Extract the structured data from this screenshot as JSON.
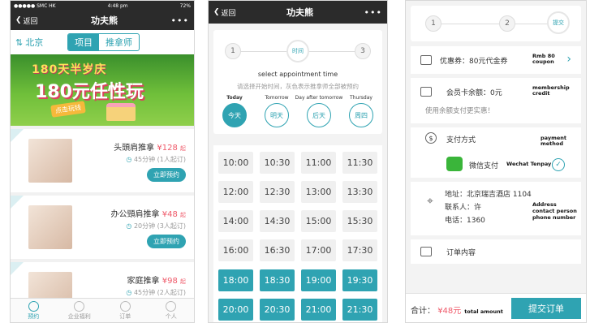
{
  "colors": {
    "accent": "#2fa3b2",
    "price": "#ef5a6a",
    "navbar": "#2b2b2b"
  },
  "screen1": {
    "status": {
      "carrier": "●●●●● SMC HK",
      "time": "4:48 pm",
      "battery": "72%"
    },
    "nav": {
      "back": "返回",
      "title": "功夫熊",
      "more": "•••"
    },
    "city": "北京",
    "segments": [
      "项目",
      "推拿师"
    ],
    "banner": {
      "line1": "180天半岁庆",
      "line2": "180元任性玩",
      "tag": "点击玩钱"
    },
    "cards": [
      {
        "name": "头頭肩推拿",
        "price": "¥128",
        "unit": "起",
        "meta": "45分钟 (1人起订)",
        "button": "立即预约"
      },
      {
        "name": "办公頸肩推拿",
        "price": "¥48",
        "unit": "起",
        "meta": "20分钟 (3人起订)",
        "button": "立即预约"
      },
      {
        "name": "家庭推拿",
        "price": "¥98",
        "unit": "起",
        "meta": "45分钟 (2人起订)",
        "button": ""
      }
    ],
    "tabs": [
      "预约",
      "企业福利",
      "订单",
      "个人"
    ]
  },
  "screen2": {
    "nav": {
      "back": "返回",
      "title": "功夫熊",
      "more": "•••"
    },
    "steps": [
      "1",
      "时间",
      "3"
    ],
    "step_caption": "select appointment time",
    "hint": "请选择开始时间，灰色表示推拿师全部被预约",
    "days": [
      {
        "en": "Today",
        "cn": "今天"
      },
      {
        "en": "Tomorrow",
        "cn": "明天"
      },
      {
        "en": "Day after tomorrow",
        "cn": "后天"
      },
      {
        "en": "Thursday",
        "cn": "周四"
      }
    ],
    "slots": [
      "10:00",
      "10:30",
      "11:00",
      "11:30",
      "12:00",
      "12:30",
      "13:00",
      "13:30",
      "14:00",
      "14:30",
      "15:00",
      "15:30",
      "16:00",
      "16:30",
      "17:00",
      "17:30",
      "18:00",
      "18:30",
      "19:00",
      "19:30",
      "20:00",
      "20:30",
      "21:00",
      "21:30"
    ],
    "available_from_index": 16
  },
  "screen3": {
    "steps": [
      "1",
      "2",
      "提交"
    ],
    "coupon": {
      "label": "优惠券：80元代金券",
      "en1": "Rmb 80",
      "en2": "coupon"
    },
    "balance": {
      "label": "会员卡余额：0元",
      "en1": "membership",
      "en2": "credit",
      "hint": "使用余额支付更实惠！"
    },
    "payment": {
      "label": "支付方式",
      "en": "payment method",
      "option": "微信支付",
      "option_en": "Wechat Tenpay"
    },
    "address": {
      "addr": "地址：北京瑞吉酒店 1104",
      "contact": "联系人：许",
      "phone": "电话：1360",
      "en1": "Address",
      "en2": "contact person",
      "en3": "phone number"
    },
    "order": "订单内容",
    "total_label": "合计：",
    "total": "¥48元",
    "total_en": "total amount",
    "submit": "提交订单"
  }
}
